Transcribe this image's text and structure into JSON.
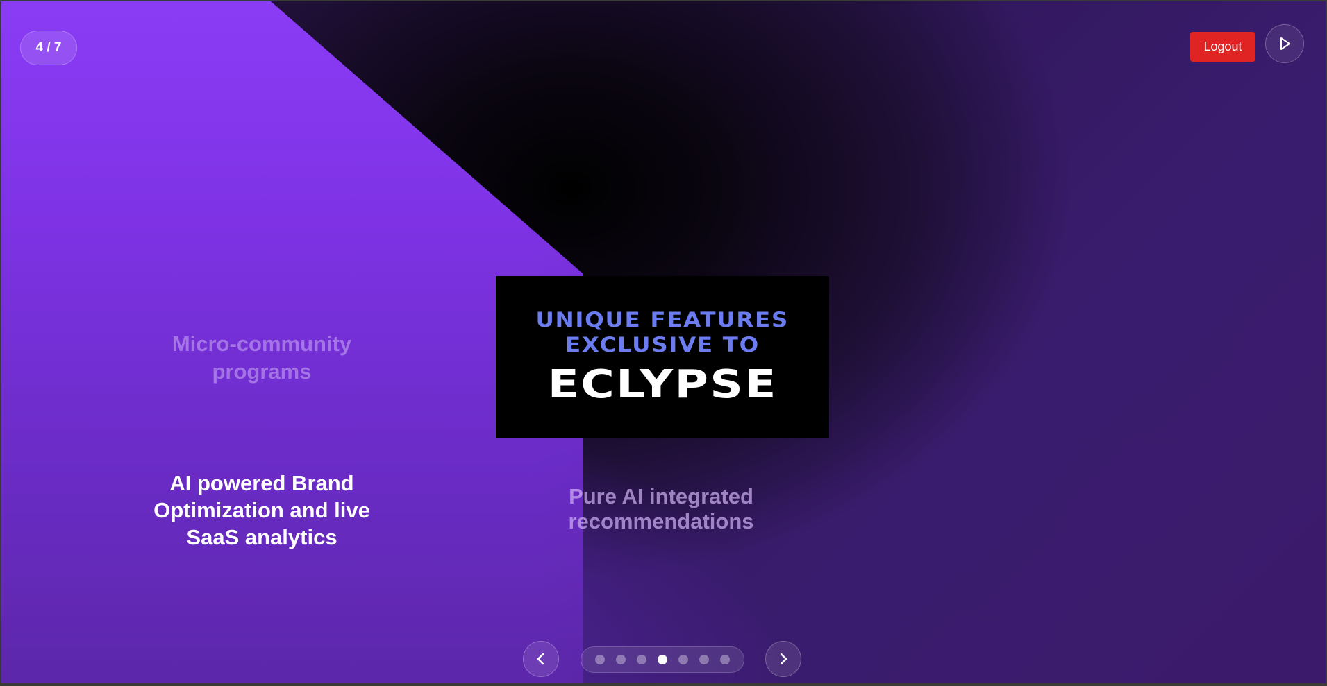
{
  "slide_counter": "4 / 7",
  "header": {
    "logout_label": "Logout",
    "play_icon": "play-icon"
  },
  "card": {
    "subtitle_line1": "UNIQUE FEATURES",
    "subtitle_line2": "EXCLUSIVE TO",
    "title": "ECLYPSE"
  },
  "features": {
    "micro_line1": "Micro-community",
    "micro_line2": "programs",
    "ai_brand_line1": "AI powered Brand",
    "ai_brand_line2": "Optimization and live",
    "ai_brand_line3": "SaaS analytics",
    "pure_ai_line1": "Pure AI integrated",
    "pure_ai_line2": "recommendations"
  },
  "navigation": {
    "prev_icon": "chevron-left-icon",
    "next_icon": "chevron-right-icon",
    "total_slides": 7,
    "active_slide": 4
  },
  "colors": {
    "logout_bg": "#e02424",
    "card_subtitle": "#6b7cf0",
    "purple_panel": "#8a3cf5"
  }
}
